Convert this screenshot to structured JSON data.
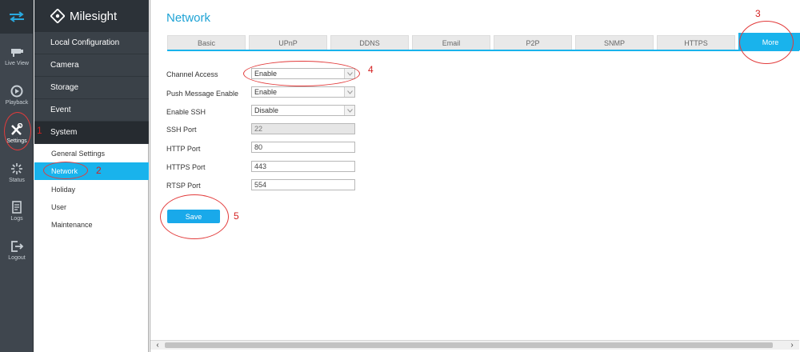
{
  "brand": {
    "name": "Milesight"
  },
  "rail": {
    "items": [
      {
        "label": "Live View",
        "icon": "live-view-icon"
      },
      {
        "label": "Playback",
        "icon": "playback-icon"
      },
      {
        "label": "Settings",
        "icon": "settings-icon"
      },
      {
        "label": "Status",
        "icon": "status-icon"
      },
      {
        "label": "Logs",
        "icon": "logs-icon"
      },
      {
        "label": "Logout",
        "icon": "logout-icon"
      }
    ]
  },
  "menu": {
    "items": [
      "Local Configuration",
      "Camera",
      "Storage",
      "Event",
      "System"
    ],
    "system_sub": [
      "General Settings",
      "Network",
      "Holiday",
      "User",
      "Maintenance"
    ]
  },
  "page": {
    "title": "Network",
    "tabs": [
      "Basic",
      "UPnP",
      "DDNS",
      "Email",
      "P2P",
      "SNMP",
      "HTTPS",
      "More"
    ],
    "active_tab": "More"
  },
  "form": {
    "channel_access": {
      "label": "Channel Access",
      "value": "Enable"
    },
    "push_message": {
      "label": "Push Message Enable",
      "value": "Enable"
    },
    "enable_ssh": {
      "label": "Enable SSH",
      "value": "Disable"
    },
    "ssh_port": {
      "label": "SSH Port",
      "value": "22"
    },
    "http_port": {
      "label": "HTTP Port",
      "value": "80"
    },
    "https_port": {
      "label": "HTTPS Port",
      "value": "443"
    },
    "rtsp_port": {
      "label": "RTSP Port",
      "value": "554"
    },
    "save_label": "Save"
  },
  "annotations": [
    "1",
    "2",
    "3",
    "4",
    "5"
  ],
  "colors": {
    "accent": "#19b3ec",
    "annotation": "#e23b3b",
    "rail_bg": "#3f464e"
  }
}
